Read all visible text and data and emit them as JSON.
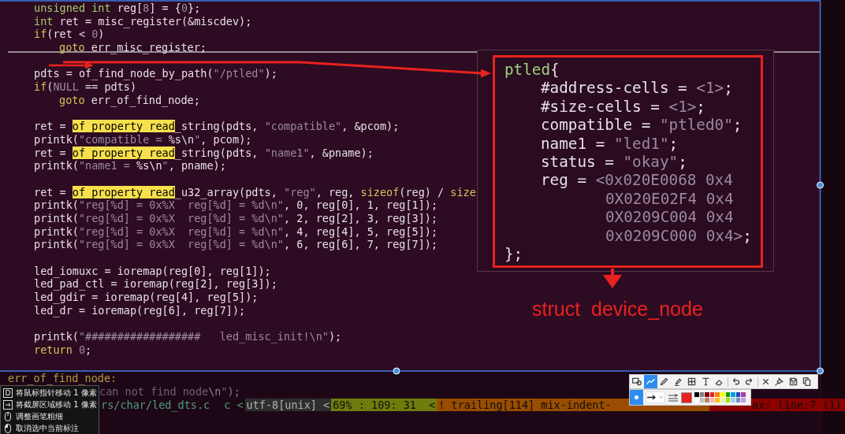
{
  "editor": {
    "lines": [
      {
        "kind": "body",
        "segments": [
          {
            "text": "unsigned int",
            "kind": "type"
          },
          {
            "text": " reg[",
            "kind": "plain"
          },
          {
            "text": "8",
            "kind": "num"
          },
          {
            "text": "] = {",
            "kind": "plain"
          },
          {
            "text": "0",
            "kind": "num"
          },
          {
            "text": "};",
            "kind": "plain"
          }
        ]
      },
      {
        "kind": "body",
        "segments": [
          {
            "text": "int",
            "kind": "type"
          },
          {
            "text": " ret = misc_register(&miscdev);",
            "kind": "plain"
          }
        ]
      },
      {
        "kind": "body",
        "segments": [
          {
            "text": "if",
            "kind": "kw"
          },
          {
            "text": "(ret < ",
            "kind": "plain"
          },
          {
            "text": "0",
            "kind": "num"
          },
          {
            "text": ")",
            "kind": "plain"
          }
        ]
      },
      {
        "kind": "nested",
        "segments": [
          {
            "text": "goto",
            "kind": "kw"
          },
          {
            "text": " err_misc_register;",
            "kind": "plain"
          }
        ]
      },
      {
        "kind": "blank"
      },
      {
        "kind": "body",
        "segments": [
          {
            "text": "pdts = of_find_node_by_path(",
            "kind": "plain"
          },
          {
            "text": "\"/ptled\"",
            "kind": "str"
          },
          {
            "text": ");",
            "kind": "plain"
          }
        ]
      },
      {
        "kind": "body",
        "segments": [
          {
            "text": "if",
            "kind": "kw"
          },
          {
            "text": "(",
            "kind": "plain"
          },
          {
            "text": "NULL",
            "kind": "num"
          },
          {
            "text": " == pdts)",
            "kind": "plain"
          }
        ]
      },
      {
        "kind": "nested",
        "segments": [
          {
            "text": "goto",
            "kind": "kw"
          },
          {
            "text": " err_of_find_node;",
            "kind": "plain"
          }
        ]
      },
      {
        "kind": "blank"
      },
      {
        "kind": "body",
        "segments": [
          {
            "text": "ret = ",
            "kind": "plain"
          },
          {
            "text": "of_property_read",
            "kind": "match"
          },
          {
            "text": "_string(pdts, ",
            "kind": "plain"
          },
          {
            "text": "\"compatible\"",
            "kind": "str"
          },
          {
            "text": ", &pcom);",
            "kind": "plain"
          }
        ]
      },
      {
        "kind": "body",
        "segments": [
          {
            "text": "printk(",
            "kind": "plain"
          },
          {
            "text": "\"compatible = ",
            "kind": "str"
          },
          {
            "text": "%s\\n",
            "kind": "plain"
          },
          {
            "text": "\"",
            "kind": "str"
          },
          {
            "text": ", pcom);",
            "kind": "plain"
          }
        ]
      },
      {
        "kind": "body",
        "segments": [
          {
            "text": "ret = ",
            "kind": "plain"
          },
          {
            "text": "of_property_read",
            "kind": "match"
          },
          {
            "text": "_string(pdts, ",
            "kind": "plain"
          },
          {
            "text": "\"name1\"",
            "kind": "str"
          },
          {
            "text": ", &pname);",
            "kind": "plain"
          }
        ]
      },
      {
        "kind": "body",
        "segments": [
          {
            "text": "printk(",
            "kind": "plain"
          },
          {
            "text": "\"name1 = ",
            "kind": "str"
          },
          {
            "text": "%s\\n",
            "kind": "plain"
          },
          {
            "text": "\"",
            "kind": "str"
          },
          {
            "text": ", pname);",
            "kind": "plain"
          }
        ]
      },
      {
        "kind": "blank"
      },
      {
        "kind": "body",
        "segments": [
          {
            "text": "ret = ",
            "kind": "plain"
          },
          {
            "text": "of_property_read",
            "kind": "match"
          },
          {
            "text": "_u32_array(pdts, ",
            "kind": "plain"
          },
          {
            "text": "\"reg\"",
            "kind": "str"
          },
          {
            "text": ", reg, ",
            "kind": "plain"
          },
          {
            "text": "sizeof",
            "kind": "kw"
          },
          {
            "text": "(reg) / ",
            "kind": "plain"
          },
          {
            "text": "size",
            "kind": "kw"
          }
        ]
      },
      {
        "kind": "body",
        "segments": [
          {
            "text": "printk(",
            "kind": "plain"
          },
          {
            "text": "\"reg[%d] = 0x%X  reg[%d] = %d\\n\"",
            "kind": "str"
          },
          {
            "text": ", 0, reg[0], 1, reg[1]);",
            "kind": "plain"
          }
        ]
      },
      {
        "kind": "body",
        "segments": [
          {
            "text": "printk(",
            "kind": "plain"
          },
          {
            "text": "\"reg[%d] = 0x%X  reg[%d] = %d\\n\"",
            "kind": "str"
          },
          {
            "text": ", 2, reg[2], 3, reg[3]);",
            "kind": "plain"
          }
        ]
      },
      {
        "kind": "body",
        "segments": [
          {
            "text": "printk(",
            "kind": "plain"
          },
          {
            "text": "\"reg[%d] = 0x%X  reg[%d] = %d\\n\"",
            "kind": "str"
          },
          {
            "text": ", 4, reg[4], 5, reg[5]);",
            "kind": "plain"
          }
        ]
      },
      {
        "kind": "body",
        "segments": [
          {
            "text": "printk(",
            "kind": "plain"
          },
          {
            "text": "\"reg[%d] = 0x%X  reg[%d] = %d\\n\"",
            "kind": "str"
          },
          {
            "text": ", 6, reg[6], 7, reg[7]);",
            "kind": "plain"
          }
        ]
      },
      {
        "kind": "blank"
      },
      {
        "kind": "body",
        "segments": [
          {
            "text": "led_iomuxc = ioremap(reg[0], reg[1]);",
            "kind": "plain"
          }
        ]
      },
      {
        "kind": "body",
        "segments": [
          {
            "text": "led_pad_ctl = ioremap(reg[2], reg[3]);",
            "kind": "plain"
          }
        ]
      },
      {
        "kind": "body",
        "segments": [
          {
            "text": "led_gdir = ioremap(reg[4], reg[5]);",
            "kind": "plain"
          }
        ]
      },
      {
        "kind": "body",
        "segments": [
          {
            "text": "led_dr = ioremap(reg[6], reg[7]);",
            "kind": "plain"
          }
        ]
      },
      {
        "kind": "blank"
      },
      {
        "kind": "body",
        "segments": [
          {
            "text": "printk(",
            "kind": "plain"
          },
          {
            "text": "\"##################   led_misc_init!\\n\"",
            "kind": "str"
          },
          {
            "text": ");",
            "kind": "plain"
          }
        ]
      },
      {
        "kind": "body",
        "segments": [
          {
            "text": "return",
            "kind": "kw"
          },
          {
            "text": " 0",
            "kind": "num"
          },
          {
            "text": ";",
            "kind": "plain"
          }
        ]
      },
      {
        "kind": "blank"
      },
      {
        "kind": "top",
        "segments": [
          {
            "text": "err_of_find_node:",
            "kind": "label"
          }
        ]
      },
      {
        "kind": "partial",
        "segments": [
          {
            "text": "can not find node",
            "kind": "str"
          },
          {
            "text": "\\n",
            "kind": "plain"
          },
          {
            "text": "\"",
            "kind": "str"
          },
          {
            "text": ");",
            "kind": "plain"
          }
        ]
      }
    ]
  },
  "status_bar": {
    "segments": [
      {
        "text": "rs/char/led_dts.c",
        "kind": "file"
      },
      {
        "text": "c <",
        "kind": "filetype"
      },
      {
        "text": "utf-8[unix] <",
        "kind": "encoding"
      },
      {
        "text": "69% : 109: 31  <",
        "kind": "position"
      },
      {
        "text": "! trailing[114] mix-indent-",
        "kind": "warning"
      },
      {
        "text": "ax: line:7 (1)",
        "kind": "error"
      }
    ]
  },
  "popup": {
    "lines": [
      {
        "kind": "top",
        "segments": [
          {
            "text": "ptled",
            "kind": "node"
          },
          {
            "text": "{",
            "kind": "plain"
          }
        ]
      },
      {
        "kind": "body",
        "segments": [
          {
            "text": "#address-cells = ",
            "kind": "plain"
          },
          {
            "text": "<1>",
            "kind": "str"
          },
          {
            "text": ";",
            "kind": "plain"
          }
        ]
      },
      {
        "kind": "body",
        "segments": [
          {
            "text": "#size-cells = ",
            "kind": "plain"
          },
          {
            "text": "<1>",
            "kind": "str"
          },
          {
            "text": ";",
            "kind": "plain"
          }
        ]
      },
      {
        "kind": "body",
        "segments": [
          {
            "text": "compatible = ",
            "kind": "plain"
          },
          {
            "text": "\"ptled0\"",
            "kind": "str"
          },
          {
            "text": ";",
            "kind": "plain"
          }
        ]
      },
      {
        "kind": "body",
        "segments": [
          {
            "text": "name1 = ",
            "kind": "plain"
          },
          {
            "text": "\"led1\"",
            "kind": "str"
          },
          {
            "text": ";",
            "kind": "plain"
          }
        ]
      },
      {
        "kind": "body",
        "segments": [
          {
            "text": "status = ",
            "kind": "plain"
          },
          {
            "text": "\"okay\"",
            "kind": "str"
          },
          {
            "text": ";",
            "kind": "plain"
          }
        ]
      },
      {
        "kind": "body",
        "segments": [
          {
            "text": "reg = ",
            "kind": "plain"
          },
          {
            "text": "<0x020E0068 0x4",
            "kind": "str"
          }
        ]
      },
      {
        "kind": "continued",
        "segments": [
          {
            "text": "0X020E02F4 0x4",
            "kind": "str"
          }
        ]
      },
      {
        "kind": "continued",
        "segments": [
          {
            "text": "0X0209C004 0x4",
            "kind": "str"
          }
        ]
      },
      {
        "kind": "continued",
        "segments": [
          {
            "text": "0x0209C000 0x4>",
            "kind": "str"
          },
          {
            "text": ";",
            "kind": "plain"
          }
        ]
      },
      {
        "kind": "top",
        "segments": [
          {
            "text": "};",
            "kind": "plain"
          }
        ]
      }
    ]
  },
  "annotation": {
    "label": "struct  device_node"
  },
  "context_menu": {
    "items": [
      {
        "kind": "key",
        "key": "D",
        "label": "将鼠标指针移动 1 像素"
      },
      {
        "kind": "arrow-key",
        "label": "将截屏区域移动 1 像素"
      },
      {
        "kind": "mouse",
        "label": "调整画笔粗细"
      },
      {
        "kind": "mouse-click",
        "label": "取消选中当前标注"
      }
    ]
  },
  "toolbar": {
    "tools": [
      {
        "kind": "shape",
        "selected": false
      },
      {
        "kind": "line",
        "selected": true
      },
      {
        "kind": "pen",
        "selected": false
      },
      {
        "kind": "marker",
        "selected": false
      },
      {
        "kind": "mosaic",
        "selected": false
      },
      {
        "kind": "text",
        "selected": false
      },
      {
        "kind": "eraser",
        "selected": false
      },
      {
        "kind": "undo",
        "selected": false
      },
      {
        "kind": "redo",
        "selected": false
      },
      {
        "kind": "close",
        "selected": false
      },
      {
        "kind": "pin",
        "selected": false
      },
      {
        "kind": "save",
        "selected": false
      },
      {
        "kind": "copy",
        "selected": false
      }
    ],
    "current_color": {
      "color": "#e8221f"
    },
    "palette": [
      {
        "color": "#000000"
      },
      {
        "color": "#808080"
      },
      {
        "color": "#800000"
      },
      {
        "color": "#e8221f"
      },
      {
        "color": "#ff8000"
      },
      {
        "color": "#ffff00"
      },
      {
        "color": "#00a000"
      },
      {
        "color": "#00a0e0"
      },
      {
        "color": "#2040c0"
      },
      {
        "color": "#a040a0"
      },
      {
        "color": "#ffffff"
      },
      {
        "color": "#c0c0c0"
      },
      {
        "color": "#c08060"
      },
      {
        "color": "#ffb0c0"
      },
      {
        "color": "#ffc000"
      },
      {
        "color": "#f0f0a0"
      },
      {
        "color": "#a0e000"
      },
      {
        "color": "#a0d0f0"
      },
      {
        "color": "#7090c0"
      },
      {
        "color": "#c0a0e0"
      }
    ]
  }
}
